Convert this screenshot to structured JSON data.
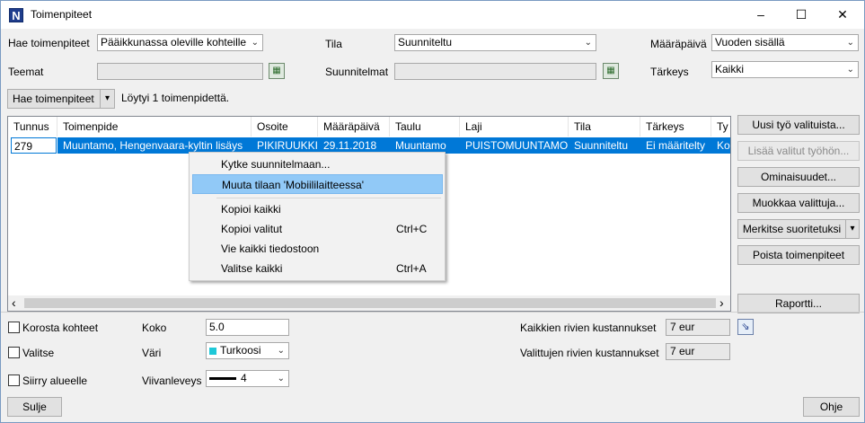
{
  "window": {
    "title": "Toimenpiteet",
    "app_icon_letter": "N",
    "minimize_glyph": "–",
    "maximize_glyph": "☐",
    "close_glyph": "✕"
  },
  "filters": {
    "hae_label": "Hae toimenpiteet",
    "hae_value": "Pääikkunassa oleville kohteille",
    "tila_label": "Tila",
    "tila_value": "Suunniteltu",
    "maarapaiva_label": "Määräpäivä",
    "maarapaiva_value": "Vuoden sisällä",
    "teemat_label": "Teemat",
    "teemat_value": "",
    "suunnitelmat_label": "Suunnitelmat",
    "suunnitelmat_value": "",
    "tarkeys_label": "Tärkeys",
    "tarkeys_value": "Kaikki"
  },
  "search": {
    "button_label": "Hae toimenpiteet",
    "dropdown_glyph": "▾",
    "result_text": "Löytyi 1 toimenpidettä."
  },
  "table": {
    "columns": [
      "Tunnus",
      "Toimenpide",
      "Osoite",
      "Määräpäivä",
      "Taulu",
      "Laji",
      "Tila",
      "Tärkeys",
      "Ty"
    ],
    "rows": [
      [
        "279",
        "Muuntamo, Hengenvaara-kyltin lisäys",
        "PIKIRUUKKI",
        "29.11.2018",
        "Muuntamo",
        "PUISTOMUUNTAMO",
        "Suunniteltu",
        "Ei määritelty",
        "Ko"
      ]
    ],
    "scroll_left": "‹",
    "scroll_right": "›"
  },
  "context_menu": {
    "items": [
      {
        "label": "Kytke suunnitelmaan...",
        "shortcut": ""
      },
      {
        "label": "Muuta tilaan 'Mobiililaitteessa'",
        "shortcut": ""
      },
      {
        "label": "Kopioi kaikki",
        "shortcut": ""
      },
      {
        "label": "Kopioi valitut",
        "shortcut": "Ctrl+C"
      },
      {
        "label": "Vie kaikki tiedostoon",
        "shortcut": ""
      },
      {
        "label": "Valitse kaikki",
        "shortcut": "Ctrl+A"
      }
    ]
  },
  "side_buttons": {
    "uusi": "Uusi työ valituista...",
    "lisaa": "Lisää valitut työhön...",
    "ominaisuudet": "Ominaisuudet...",
    "muokkaa": "Muokkaa valittuja...",
    "merkitse": "Merkitse suoritetuksi",
    "merkitse_arrow": "▾",
    "poista": "Poista toimenpiteet",
    "raportti": "Raportti..."
  },
  "bottom": {
    "korosta_label": "Korosta kohteet",
    "valitse_label": "Valitse",
    "siirry_label": "Siirry alueelle",
    "koko_label": "Koko",
    "koko_value": "5.0",
    "vari_label": "Väri",
    "vari_value": "Turkoosi",
    "viiva_label": "Viivanleveys",
    "viiva_value": "4",
    "kaikki_cost_label": "Kaikkien rivien kustannukset",
    "kaikki_cost_value": "7 eur",
    "valitut_cost_label": "Valittujen rivien kustannukset",
    "valitut_cost_value": "7 eur",
    "sulje": "Sulje",
    "ohje": "Ohje"
  },
  "colors": {
    "selection": "#0078d7",
    "menu_highlight": "#91c9f7",
    "swatch_turkoosi": "#1ec8d8"
  }
}
